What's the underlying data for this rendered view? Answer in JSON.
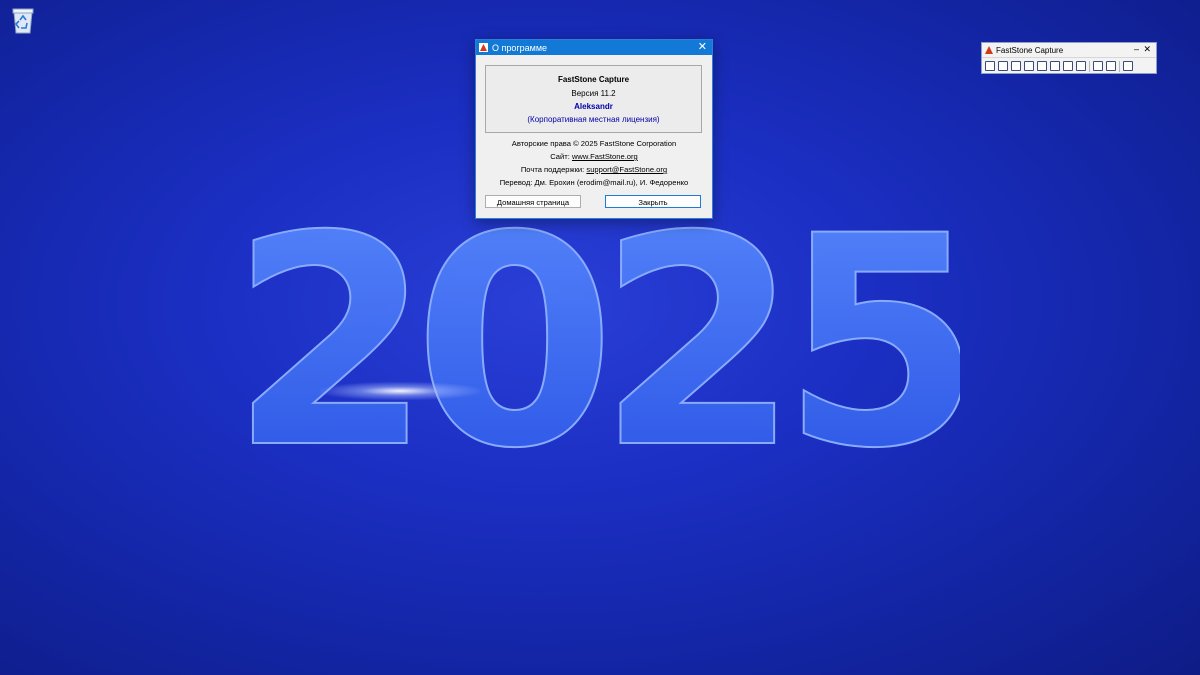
{
  "desktop": {
    "icons": [
      {
        "name": "recycle-bin-icon"
      }
    ],
    "wallpaper_text": "2025",
    "colors": {
      "background": "#1b2fc4",
      "digits": "#3a6cf2"
    }
  },
  "about_dialog": {
    "title": "О программе",
    "product": "FastStone Capture",
    "version": "Версия 11.2",
    "user": "Aleksandr",
    "license": "(Корпоративная местная лицензия)",
    "copyright": "Авторские права © 2025 FastStone Corporation",
    "site_label": "Сайт: ",
    "site_link": "www.FastStone.org",
    "support_label": "Почта поддержки: ",
    "support_link": "support@FastStone.org",
    "translation": "Перевод: Дм. Ерохин (erodim@mail.ru), И. Федоренко",
    "buttons": {
      "home": "Домашняя страница",
      "close": "Закрыть"
    }
  },
  "fs_toolbar": {
    "title": "FastStone Capture",
    "icons": [
      "open-icon",
      "capture-window-icon",
      "capture-rect-icon",
      "capture-freehand-icon",
      "capture-fullscreen-icon",
      "capture-scroll-icon",
      "capture-fixed-icon",
      "record-video-icon",
      "delay-timer-icon",
      "output-settings-icon",
      "settings-icon"
    ]
  }
}
